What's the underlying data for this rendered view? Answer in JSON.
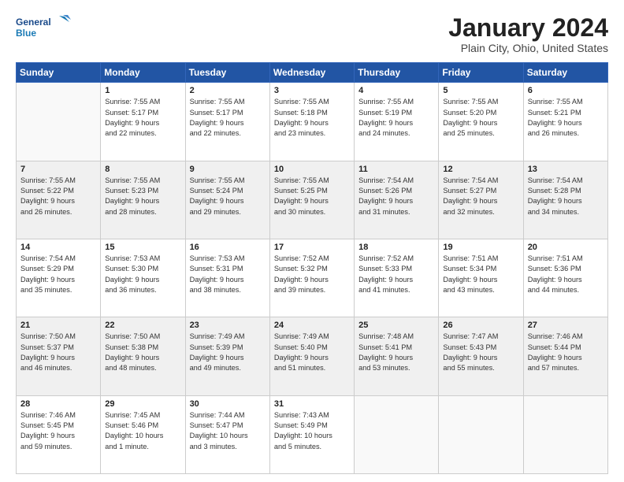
{
  "header": {
    "logo_line1": "General",
    "logo_line2": "Blue",
    "month": "January 2024",
    "location": "Plain City, Ohio, United States"
  },
  "weekdays": [
    "Sunday",
    "Monday",
    "Tuesday",
    "Wednesday",
    "Thursday",
    "Friday",
    "Saturday"
  ],
  "weeks": [
    [
      {
        "day": "",
        "info": ""
      },
      {
        "day": "1",
        "info": "Sunrise: 7:55 AM\nSunset: 5:17 PM\nDaylight: 9 hours\nand 22 minutes."
      },
      {
        "day": "2",
        "info": "Sunrise: 7:55 AM\nSunset: 5:17 PM\nDaylight: 9 hours\nand 22 minutes."
      },
      {
        "day": "3",
        "info": "Sunrise: 7:55 AM\nSunset: 5:18 PM\nDaylight: 9 hours\nand 23 minutes."
      },
      {
        "day": "4",
        "info": "Sunrise: 7:55 AM\nSunset: 5:19 PM\nDaylight: 9 hours\nand 24 minutes."
      },
      {
        "day": "5",
        "info": "Sunrise: 7:55 AM\nSunset: 5:20 PM\nDaylight: 9 hours\nand 25 minutes."
      },
      {
        "day": "6",
        "info": "Sunrise: 7:55 AM\nSunset: 5:21 PM\nDaylight: 9 hours\nand 26 minutes."
      }
    ],
    [
      {
        "day": "7",
        "info": "Sunrise: 7:55 AM\nSunset: 5:22 PM\nDaylight: 9 hours\nand 26 minutes."
      },
      {
        "day": "8",
        "info": "Sunrise: 7:55 AM\nSunset: 5:23 PM\nDaylight: 9 hours\nand 28 minutes."
      },
      {
        "day": "9",
        "info": "Sunrise: 7:55 AM\nSunset: 5:24 PM\nDaylight: 9 hours\nand 29 minutes."
      },
      {
        "day": "10",
        "info": "Sunrise: 7:55 AM\nSunset: 5:25 PM\nDaylight: 9 hours\nand 30 minutes."
      },
      {
        "day": "11",
        "info": "Sunrise: 7:54 AM\nSunset: 5:26 PM\nDaylight: 9 hours\nand 31 minutes."
      },
      {
        "day": "12",
        "info": "Sunrise: 7:54 AM\nSunset: 5:27 PM\nDaylight: 9 hours\nand 32 minutes."
      },
      {
        "day": "13",
        "info": "Sunrise: 7:54 AM\nSunset: 5:28 PM\nDaylight: 9 hours\nand 34 minutes."
      }
    ],
    [
      {
        "day": "14",
        "info": "Sunrise: 7:54 AM\nSunset: 5:29 PM\nDaylight: 9 hours\nand 35 minutes."
      },
      {
        "day": "15",
        "info": "Sunrise: 7:53 AM\nSunset: 5:30 PM\nDaylight: 9 hours\nand 36 minutes."
      },
      {
        "day": "16",
        "info": "Sunrise: 7:53 AM\nSunset: 5:31 PM\nDaylight: 9 hours\nand 38 minutes."
      },
      {
        "day": "17",
        "info": "Sunrise: 7:52 AM\nSunset: 5:32 PM\nDaylight: 9 hours\nand 39 minutes."
      },
      {
        "day": "18",
        "info": "Sunrise: 7:52 AM\nSunset: 5:33 PM\nDaylight: 9 hours\nand 41 minutes."
      },
      {
        "day": "19",
        "info": "Sunrise: 7:51 AM\nSunset: 5:34 PM\nDaylight: 9 hours\nand 43 minutes."
      },
      {
        "day": "20",
        "info": "Sunrise: 7:51 AM\nSunset: 5:36 PM\nDaylight: 9 hours\nand 44 minutes."
      }
    ],
    [
      {
        "day": "21",
        "info": "Sunrise: 7:50 AM\nSunset: 5:37 PM\nDaylight: 9 hours\nand 46 minutes."
      },
      {
        "day": "22",
        "info": "Sunrise: 7:50 AM\nSunset: 5:38 PM\nDaylight: 9 hours\nand 48 minutes."
      },
      {
        "day": "23",
        "info": "Sunrise: 7:49 AM\nSunset: 5:39 PM\nDaylight: 9 hours\nand 49 minutes."
      },
      {
        "day": "24",
        "info": "Sunrise: 7:49 AM\nSunset: 5:40 PM\nDaylight: 9 hours\nand 51 minutes."
      },
      {
        "day": "25",
        "info": "Sunrise: 7:48 AM\nSunset: 5:41 PM\nDaylight: 9 hours\nand 53 minutes."
      },
      {
        "day": "26",
        "info": "Sunrise: 7:47 AM\nSunset: 5:43 PM\nDaylight: 9 hours\nand 55 minutes."
      },
      {
        "day": "27",
        "info": "Sunrise: 7:46 AM\nSunset: 5:44 PM\nDaylight: 9 hours\nand 57 minutes."
      }
    ],
    [
      {
        "day": "28",
        "info": "Sunrise: 7:46 AM\nSunset: 5:45 PM\nDaylight: 9 hours\nand 59 minutes."
      },
      {
        "day": "29",
        "info": "Sunrise: 7:45 AM\nSunset: 5:46 PM\nDaylight: 10 hours\nand 1 minute."
      },
      {
        "day": "30",
        "info": "Sunrise: 7:44 AM\nSunset: 5:47 PM\nDaylight: 10 hours\nand 3 minutes."
      },
      {
        "day": "31",
        "info": "Sunrise: 7:43 AM\nSunset: 5:49 PM\nDaylight: 10 hours\nand 5 minutes."
      },
      {
        "day": "",
        "info": ""
      },
      {
        "day": "",
        "info": ""
      },
      {
        "day": "",
        "info": ""
      }
    ]
  ]
}
